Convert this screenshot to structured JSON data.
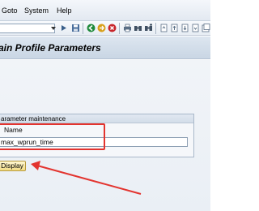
{
  "menubar": {
    "items": [
      "Goto",
      "System",
      "Help"
    ]
  },
  "toolbar": {
    "command_value": "",
    "icons": [
      "dropdown-icon",
      "save-icon",
      "back-icon",
      "exit-icon",
      "cancel-icon",
      "print-icon",
      "find-icon",
      "find-next-icon",
      "first-page-icon",
      "previous-page-icon",
      "next-page-icon",
      "last-page-icon"
    ]
  },
  "title": "ain Profile Parameters",
  "group": {
    "title": "arameter maintenance",
    "name_label": "Name",
    "name_value": "max_wprun_time",
    "display_label": "Display"
  },
  "annotation": {
    "color": "#e3342f"
  },
  "colors": {
    "display_button": "#f2dc85",
    "title_bar": "#c9d6e4"
  }
}
